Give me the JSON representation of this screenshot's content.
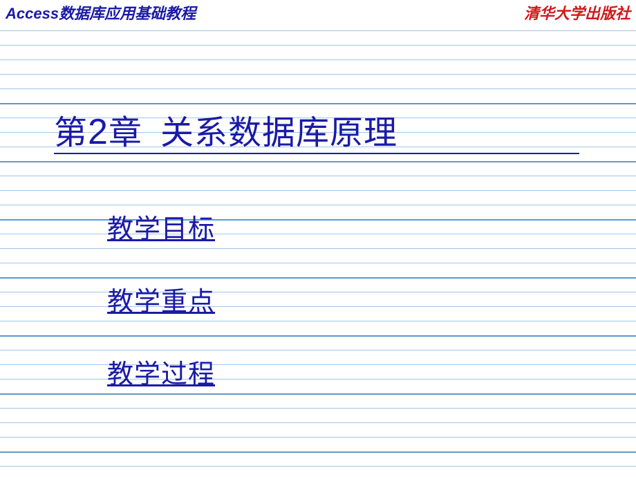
{
  "header": {
    "left": "Access数据库应用基础教程",
    "right": "清华大学出版社"
  },
  "chapter": {
    "prefix": "第",
    "number": "2",
    "suffix": "章",
    "title": "关系数据库原理"
  },
  "links": [
    "教学目标",
    "教学重点",
    "教学过程"
  ]
}
